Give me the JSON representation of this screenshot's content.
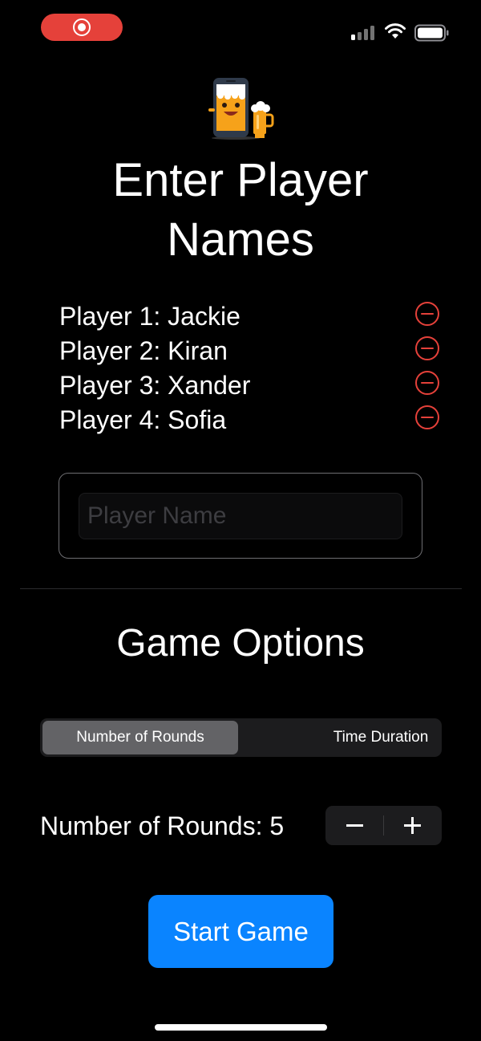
{
  "page": {
    "title": "Enter Player Names"
  },
  "players": [
    {
      "label": "Player 1: Jackie"
    },
    {
      "label": "Player 2: Kiran"
    },
    {
      "label": "Player 3: Xander"
    },
    {
      "label": "Player 4: Sofia"
    }
  ],
  "name_input": {
    "placeholder": "Player Name",
    "value": ""
  },
  "options": {
    "title": "Game Options",
    "segments": [
      {
        "label": "Number of Rounds",
        "selected": true
      },
      {
        "label": "Time Duration",
        "selected": false
      }
    ],
    "rounds_label": "Number of Rounds: 5",
    "rounds_value": 5
  },
  "start_button": {
    "label": "Start Game"
  },
  "colors": {
    "background": "#000000",
    "accent": "#0a84ff",
    "destructive": "#e5413a",
    "recording": "#e5413a"
  },
  "icons": {
    "recording": "screen-recording-icon",
    "signal": "cellular-signal-icon",
    "wifi": "wifi-icon",
    "battery": "battery-icon",
    "logo": "phone-and-beer-mascot-icon",
    "remove": "minus-circle-icon",
    "decrement": "minus-icon",
    "increment": "plus-icon"
  }
}
